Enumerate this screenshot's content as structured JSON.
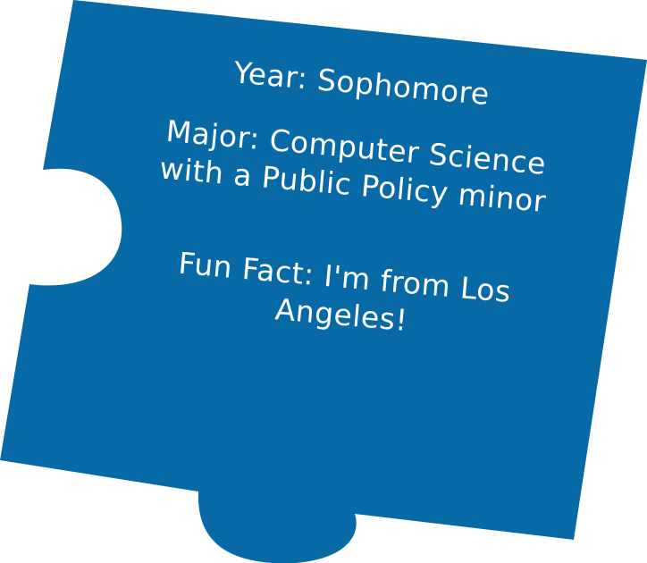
{
  "puzzle_piece": {
    "color": "#0769a6",
    "year_line": "Year: Sophomore",
    "major_line_1": "Major: Computer Science",
    "major_line_2": "with a Public Policy minor",
    "fun_fact_line_1": "Fun Fact: I'm from Los",
    "fun_fact_line_2": "Angeles!"
  }
}
